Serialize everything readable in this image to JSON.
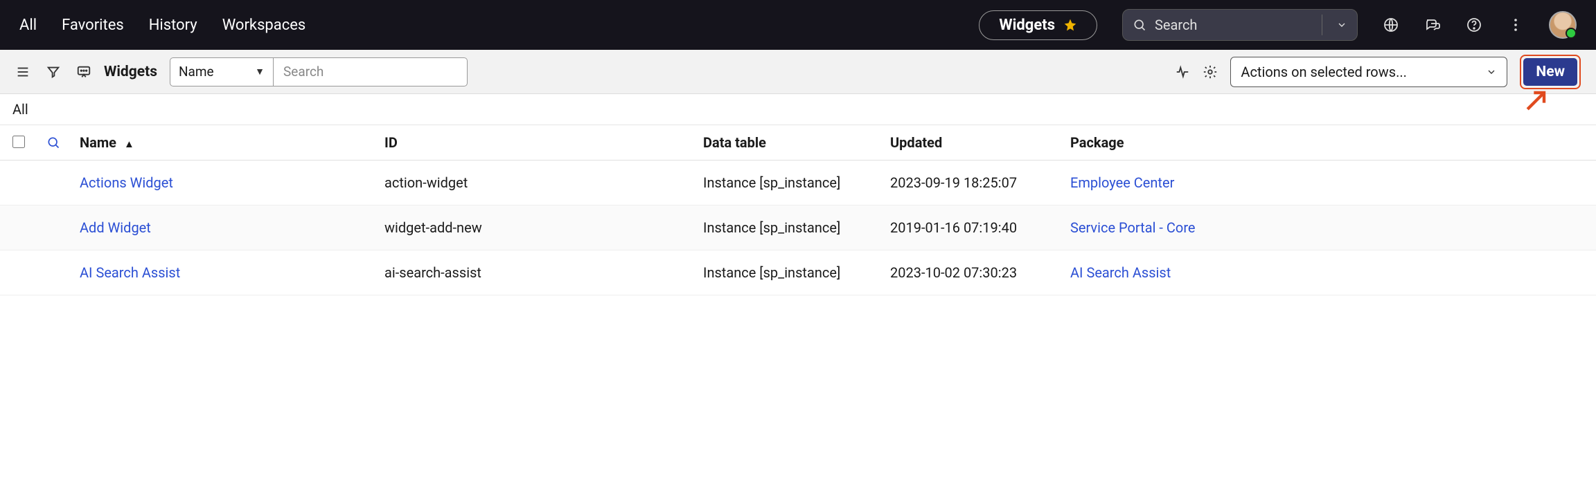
{
  "topnav": {
    "links": [
      "All",
      "Favorites",
      "History",
      "Workspaces"
    ],
    "pill_label": "Widgets",
    "search_placeholder": "Search"
  },
  "toolbar": {
    "title": "Widgets",
    "field_picker_value": "Name",
    "search_placeholder": "Search",
    "actions_placeholder": "Actions on selected rows...",
    "new_label": "New"
  },
  "crumb": {
    "text": "All"
  },
  "table": {
    "columns": {
      "name": "Name",
      "id": "ID",
      "data_table": "Data table",
      "updated": "Updated",
      "package": "Package"
    },
    "rows": [
      {
        "name": "Actions Widget",
        "id": "action-widget",
        "data_table": "Instance [sp_instance]",
        "updated": "2023-09-19 18:25:07",
        "package": "Employee Center"
      },
      {
        "name": "Add Widget",
        "id": "widget-add-new",
        "data_table": "Instance [sp_instance]",
        "updated": "2019-01-16 07:19:40",
        "package": "Service Portal - Core"
      },
      {
        "name": "AI Search Assist",
        "id": "ai-search-assist",
        "data_table": "Instance [sp_instance]",
        "updated": "2023-10-02 07:30:23",
        "package": "AI Search Assist"
      }
    ]
  }
}
